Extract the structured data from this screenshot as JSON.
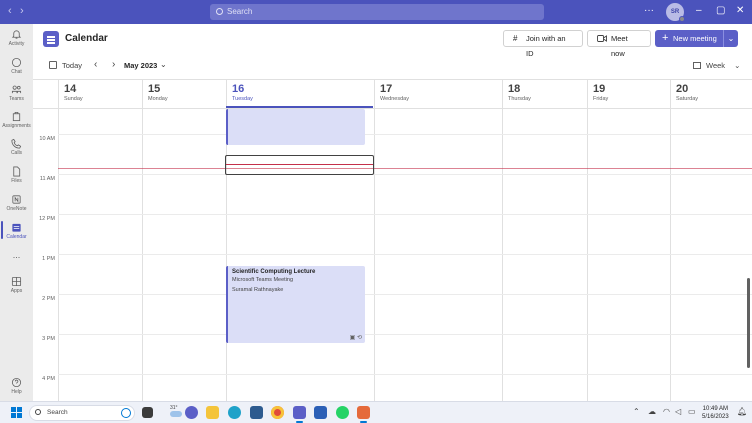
{
  "titlebar": {
    "search_placeholder": "Search",
    "avatar_initials": "SR",
    "colors": {
      "bar": "#4b53bc"
    }
  },
  "rail": {
    "items": [
      {
        "label": "Activity",
        "icon": "bell-icon"
      },
      {
        "label": "Chat",
        "icon": "chat-icon"
      },
      {
        "label": "Teams",
        "icon": "teams-icon"
      },
      {
        "label": "Assignments",
        "icon": "assignments-icon"
      },
      {
        "label": "Calls",
        "icon": "phone-icon"
      },
      {
        "label": "Files",
        "icon": "file-icon"
      },
      {
        "label": "OneNote",
        "icon": "onenote-icon"
      },
      {
        "label": "Calendar",
        "icon": "calendar-icon",
        "active": true
      },
      {
        "label": "...",
        "icon": "more-icon"
      },
      {
        "label": "Apps",
        "icon": "apps-icon"
      },
      {
        "label": "Help",
        "icon": "help-icon"
      }
    ]
  },
  "header": {
    "title": "Calendar",
    "join_label": "Join with an ID",
    "meet_label": "Meet now",
    "new_meeting_label": "New meeting"
  },
  "nav": {
    "today_label": "Today",
    "month_label": "May 2023",
    "view_label": "Week"
  },
  "days": [
    {
      "num": "14",
      "name": "Sunday"
    },
    {
      "num": "15",
      "name": "Monday"
    },
    {
      "num": "16",
      "name": "Tuesday",
      "today": true
    },
    {
      "num": "17",
      "name": "Wednesday"
    },
    {
      "num": "18",
      "name": "Thursday"
    },
    {
      "num": "19",
      "name": "Friday"
    },
    {
      "num": "20",
      "name": "Saturday"
    }
  ],
  "times": [
    "10 AM",
    "11 AM",
    "12 PM",
    "1 PM",
    "2 PM",
    "3 PM",
    "4 PM"
  ],
  "events": {
    "lecture": {
      "title": "Scientific Computing Lecture",
      "location": "Microsoft Teams Meeting",
      "organizer": "Suramal Rathnayake"
    }
  },
  "taskbar": {
    "search_label": "Search",
    "weather": "31°",
    "time": "10:49 AM",
    "date": "5/16/2023"
  }
}
